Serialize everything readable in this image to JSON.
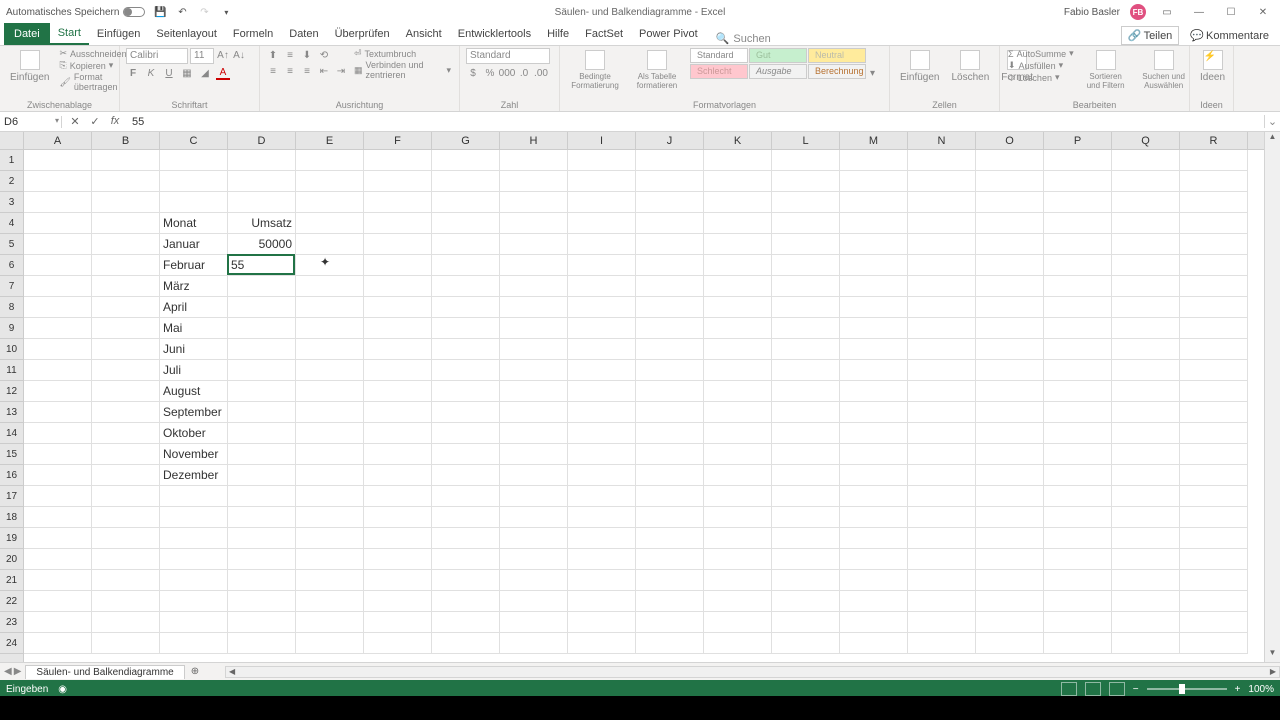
{
  "titlebar": {
    "autosave_label": "Automatisches Speichern",
    "doc_title": "Säulen- und Balkendiagramme - Excel",
    "user_name": "Fabio Basler",
    "user_initials": "FB"
  },
  "ribbon_tabs": {
    "file": "Datei",
    "items": [
      "Start",
      "Einfügen",
      "Seitenlayout",
      "Formeln",
      "Daten",
      "Überprüfen",
      "Ansicht",
      "Entwicklertools",
      "Hilfe",
      "FactSet",
      "Power Pivot"
    ],
    "active_index": 0,
    "search": "Suchen",
    "share": "Teilen",
    "comments": "Kommentare"
  },
  "ribbon": {
    "clipboard": {
      "paste": "Einfügen",
      "cut": "Ausschneiden",
      "copy": "Kopieren",
      "format_painter": "Format übertragen",
      "label": "Zwischenablage"
    },
    "font": {
      "name": "Calibri",
      "size": "11",
      "label": "Schriftart"
    },
    "alignment": {
      "wrap": "Textumbruch",
      "merge": "Verbinden und zentrieren",
      "label": "Ausrichtung"
    },
    "number": {
      "format": "Standard",
      "label": "Zahl"
    },
    "styles": {
      "cond": "Bedingte Formatierung",
      "table": "Als Tabelle formatieren",
      "s1": "Standard",
      "s2": "Gut",
      "s3": "Neutral",
      "s4": "Schlecht",
      "s5": "Ausgabe",
      "s6": "Berechnung",
      "label": "Formatvorlagen"
    },
    "cells": {
      "insert": "Einfügen",
      "delete": "Löschen",
      "format": "Format",
      "label": "Zellen"
    },
    "editing": {
      "autosum": "AutoSumme",
      "fill": "Ausfüllen",
      "clear": "Löschen",
      "sort": "Sortieren und Filtern",
      "find": "Suchen und Auswählen",
      "label": "Bearbeiten"
    },
    "ideas": {
      "btn": "Ideen",
      "label": "Ideen"
    }
  },
  "formula_bar": {
    "cell_ref": "D6",
    "formula": "55"
  },
  "grid": {
    "columns": [
      "A",
      "B",
      "C",
      "D",
      "E",
      "F",
      "G",
      "H",
      "I",
      "J",
      "K",
      "L",
      "M",
      "N",
      "O",
      "P",
      "Q",
      "R"
    ],
    "row_count": 24,
    "data": {
      "C4": "Monat",
      "D4": "Umsatz",
      "C5": "Januar",
      "D5": "50000",
      "C6": "Februar",
      "D6": "55",
      "C7": "März",
      "C8": "April",
      "C9": "Mai",
      "C10": "Juni",
      "C11": "Juli",
      "C12": "August",
      "C13": "September",
      "C14": "Oktober",
      "C15": "November",
      "C16": "Dezember"
    },
    "active_cell": "D6"
  },
  "sheet": {
    "name": "Säulen- und Balkendiagramme"
  },
  "status": {
    "mode": "Eingeben",
    "zoom": "100%"
  }
}
